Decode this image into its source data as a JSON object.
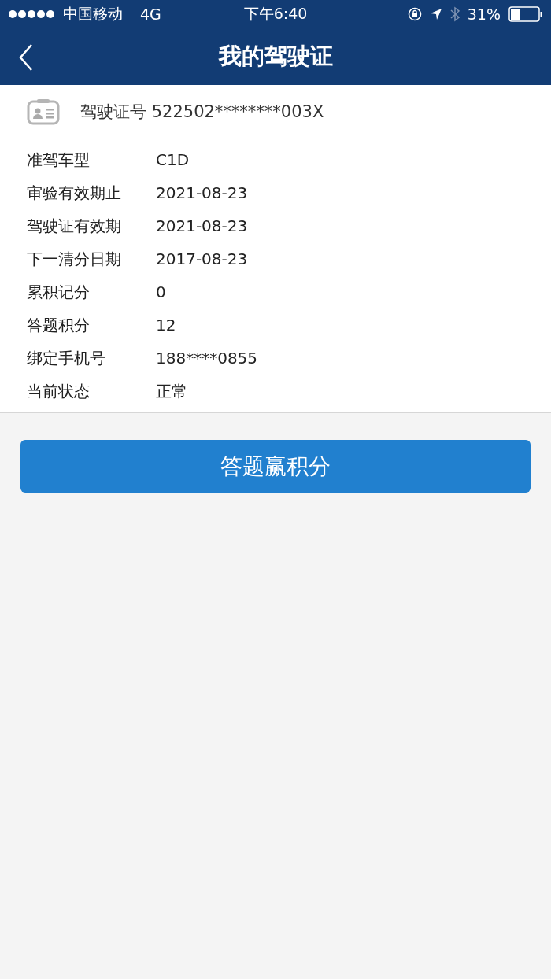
{
  "status_bar": {
    "carrier": "中国移动",
    "network": "4G",
    "time": "下午6:40",
    "battery": "31%"
  },
  "nav": {
    "title": "我的驾驶证"
  },
  "license": {
    "label": "驾驶证号",
    "number": "522502********003X"
  },
  "details": [
    {
      "label": "准驾车型",
      "value": "C1D"
    },
    {
      "label": "审验有效期止",
      "value": "2021-08-23"
    },
    {
      "label": "驾驶证有效期",
      "value": "2021-08-23"
    },
    {
      "label": "下一清分日期",
      "value": "2017-08-23"
    },
    {
      "label": "累积记分",
      "value": "0"
    },
    {
      "label": "答题积分",
      "value": "12"
    },
    {
      "label": "绑定手机号",
      "value": "188****0855"
    },
    {
      "label": "当前状态",
      "value": "正常"
    }
  ],
  "action_button": "答题赢积分"
}
